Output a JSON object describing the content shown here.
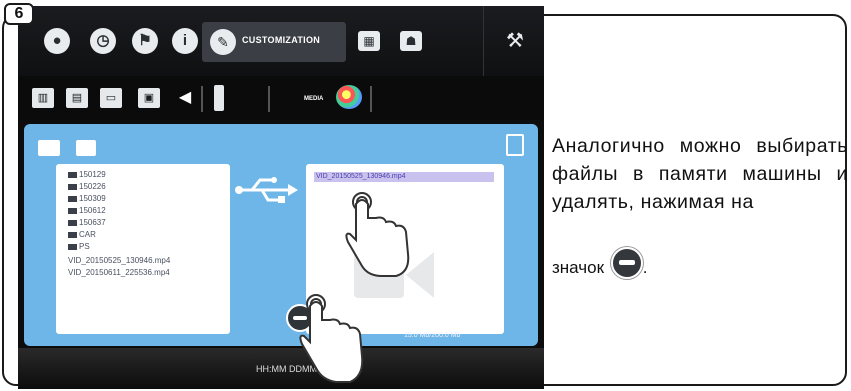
{
  "step": "6",
  "topbar": {
    "active_tab_label": "CUSTOMIZATION",
    "icons": [
      "water-drop-icon",
      "clock-icon",
      "flag-icon",
      "info-icon",
      "pen-icon",
      "keyboard-icon",
      "driver-icon",
      "wrench-icon"
    ]
  },
  "subbar": {
    "media_label": "MEDIA",
    "icons": [
      "book-icon",
      "book-open-icon",
      "screen-icon",
      "film-icon",
      "speaker-icon",
      "usb-stick-icon",
      "palette-icon"
    ]
  },
  "panel": {
    "left_files": [
      "150129",
      "150226",
      "150309",
      "150612",
      "150637",
      "CAR",
      "PS",
      "VID_20150525_130946.mp4",
      "VID_20150611_225536.mp4"
    ],
    "right_selected_file": "VID_20150525_130946.mp4",
    "right_caption": "15.0 Mb/200.0 Mb"
  },
  "bottombar": {
    "clock": "HH:MM DDMM",
    "sound": "♡ ◂"
  },
  "instruction": {
    "text": "Аналогично можно выбирать файлы в памяти машины и удалять, нажимая на",
    "icon_line_prefix": "значок",
    "icon_line_suffix": "."
  },
  "colors": {
    "panel": "#6fb6e8",
    "selection": "#c9c2ef"
  }
}
